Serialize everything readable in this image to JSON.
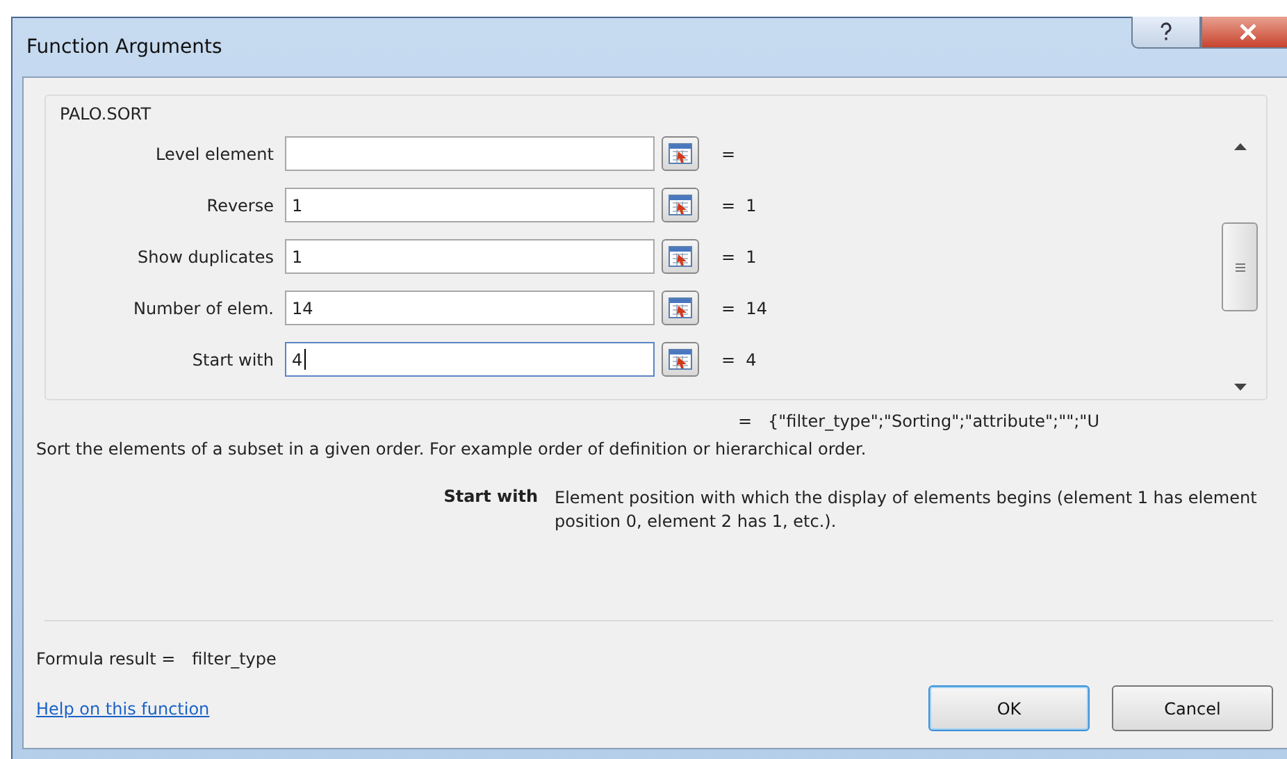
{
  "window": {
    "title": "Function Arguments"
  },
  "function_name": "PALO.SORT",
  "arguments": [
    {
      "label": "Level element",
      "result": "=",
      "focused": false
    },
    {
      "label": "Reverse",
      "value": "1",
      "result": "=  1",
      "focused": false
    },
    {
      "label": "Show duplicates",
      "value": "1",
      "result": "=  1",
      "focused": false
    },
    {
      "label": "Number of elem.",
      "value": "14",
      "result": "=  14",
      "focused": false
    },
    {
      "label": "Start with",
      "value": "4",
      "result": "=  4",
      "focused": true
    }
  ],
  "function_result": "=   {\"filter_type\";\"Sorting\";\"attribute\";\"\";\"U",
  "description": "Sort the elements of a subset in a given order. For example order of definition or hierarchical order.",
  "argument_help": {
    "name": "Start with",
    "text": "Element position with which the display of elements begins (element 1 has element position 0, element 2 has 1, etc.)."
  },
  "formula_result": {
    "label": "Formula result =",
    "value": "filter_type"
  },
  "help_link": "Help on this function",
  "buttons": [
    {
      "label": "OK",
      "default": true
    },
    {
      "label": "Cancel",
      "default": false
    }
  ]
}
